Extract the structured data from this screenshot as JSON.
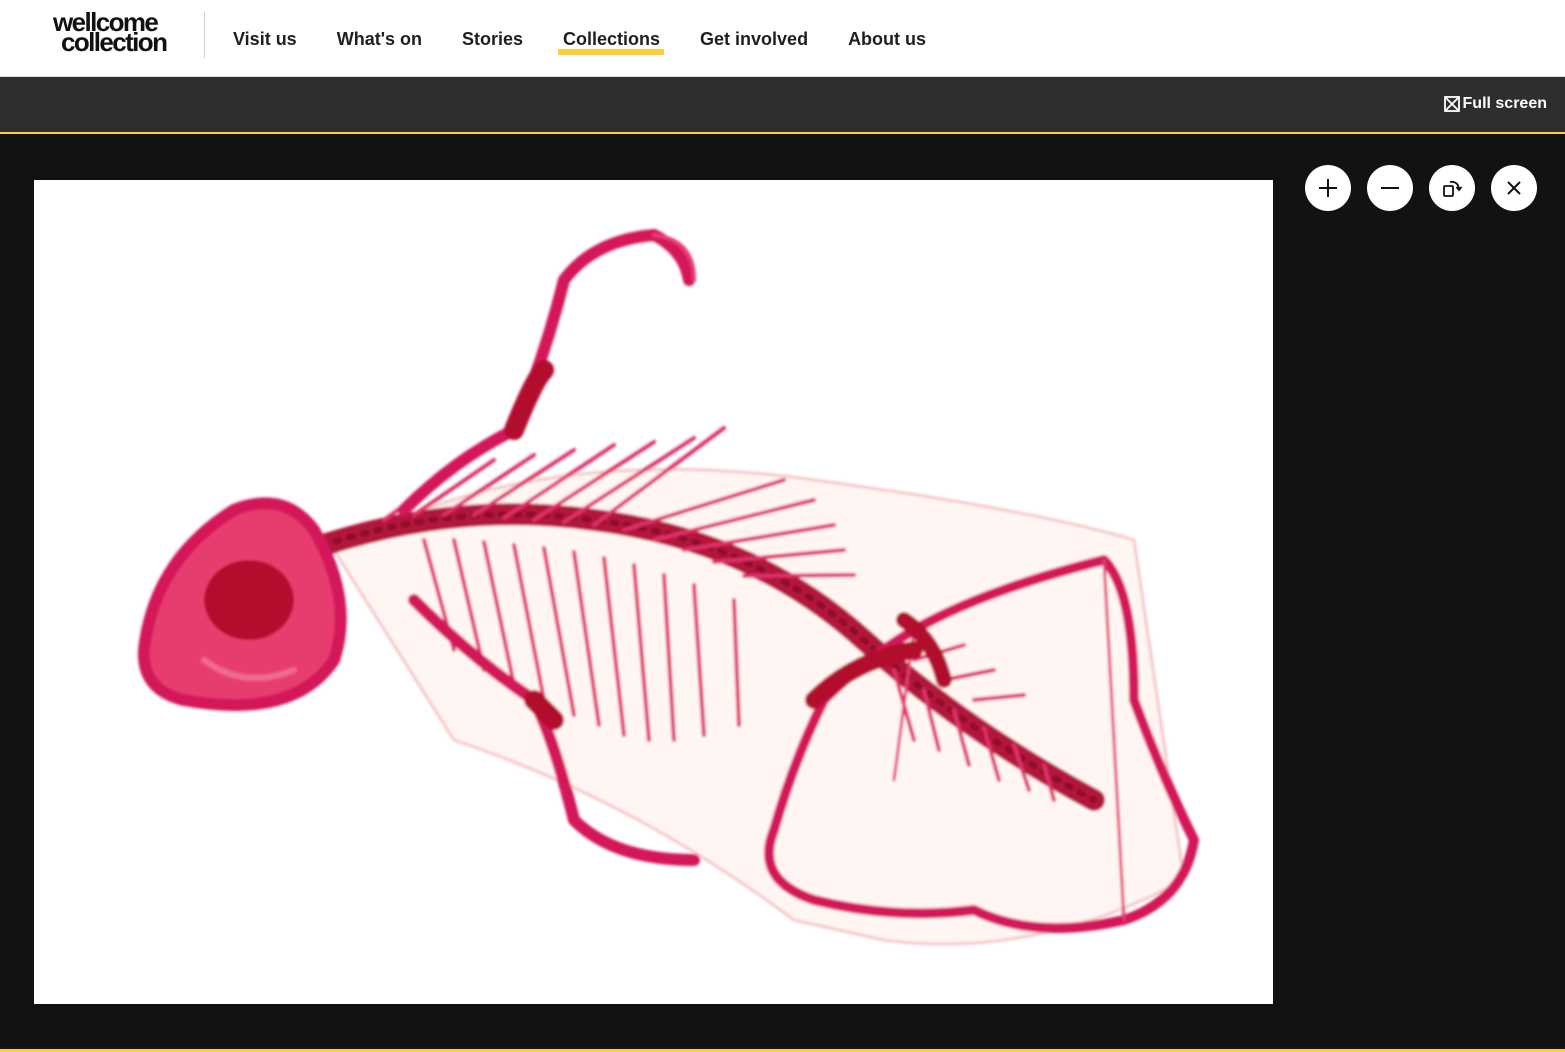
{
  "header": {
    "logo_line1": "wellcome",
    "logo_line2": "collection",
    "nav": [
      {
        "label": "Visit us",
        "active": false
      },
      {
        "label": "What's on",
        "active": false
      },
      {
        "label": "Stories",
        "active": false
      },
      {
        "label": "Collections",
        "active": true
      },
      {
        "label": "Get involved",
        "active": false
      },
      {
        "label": "About us",
        "active": false
      }
    ]
  },
  "toolbar": {
    "fullscreen_label": "Full screen",
    "fullscreen_icon": "expand-icon"
  },
  "viewer": {
    "image_alt": "Cleared and stained skeleton specimen, stained magenta, on white background",
    "controls": [
      {
        "name": "zoom-in-button",
        "icon": "plus-icon"
      },
      {
        "name": "zoom-out-button",
        "icon": "minus-icon"
      },
      {
        "name": "rotate-button",
        "icon": "rotate-icon"
      },
      {
        "name": "close-button",
        "icon": "close-icon"
      }
    ]
  },
  "colors": {
    "accent": "#ffce3c",
    "toolbar_bg": "#2e2e2e",
    "viewer_bg": "#121212",
    "specimen": "#d4145a"
  }
}
